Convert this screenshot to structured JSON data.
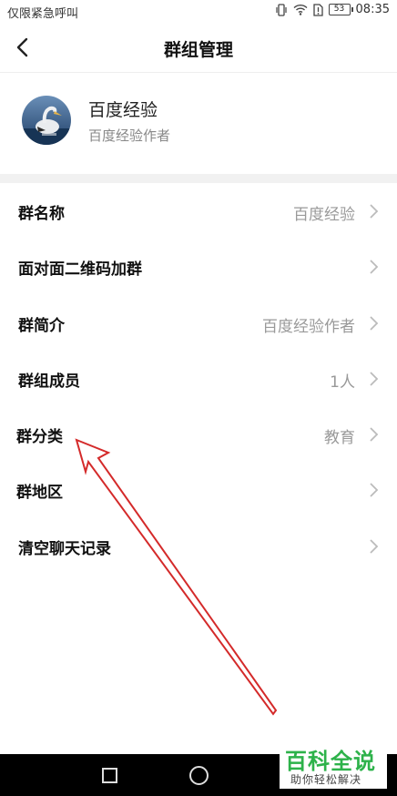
{
  "status_bar": {
    "carrier_text": "仅限紧急呼叫",
    "battery": "53",
    "time": "08:35",
    "icons": [
      "vibrate-icon",
      "wifi-icon",
      "sim-icon",
      "battery-icon"
    ]
  },
  "nav": {
    "title": "群组管理",
    "back_icon": "chevron-left-icon"
  },
  "profile": {
    "name": "百度经验",
    "subtitle": "百度经验作者"
  },
  "settings": {
    "items": [
      {
        "label": "群名称",
        "value": "百度经验"
      },
      {
        "label": "面对面二维码加群",
        "value": ""
      },
      {
        "label": "群简介",
        "value": "百度经验作者"
      },
      {
        "label": "群组成员",
        "value": "1人"
      },
      {
        "label": "群分类",
        "value": "教育"
      },
      {
        "label": "群地区",
        "value": ""
      },
      {
        "label": "清空聊天记录",
        "value": ""
      }
    ]
  },
  "watermark": {
    "main": "百科全说",
    "sub": "助你轻松解决"
  },
  "colors": {
    "annotation_arrow": "#d42a2a",
    "watermark_green": "#2db24a"
  }
}
